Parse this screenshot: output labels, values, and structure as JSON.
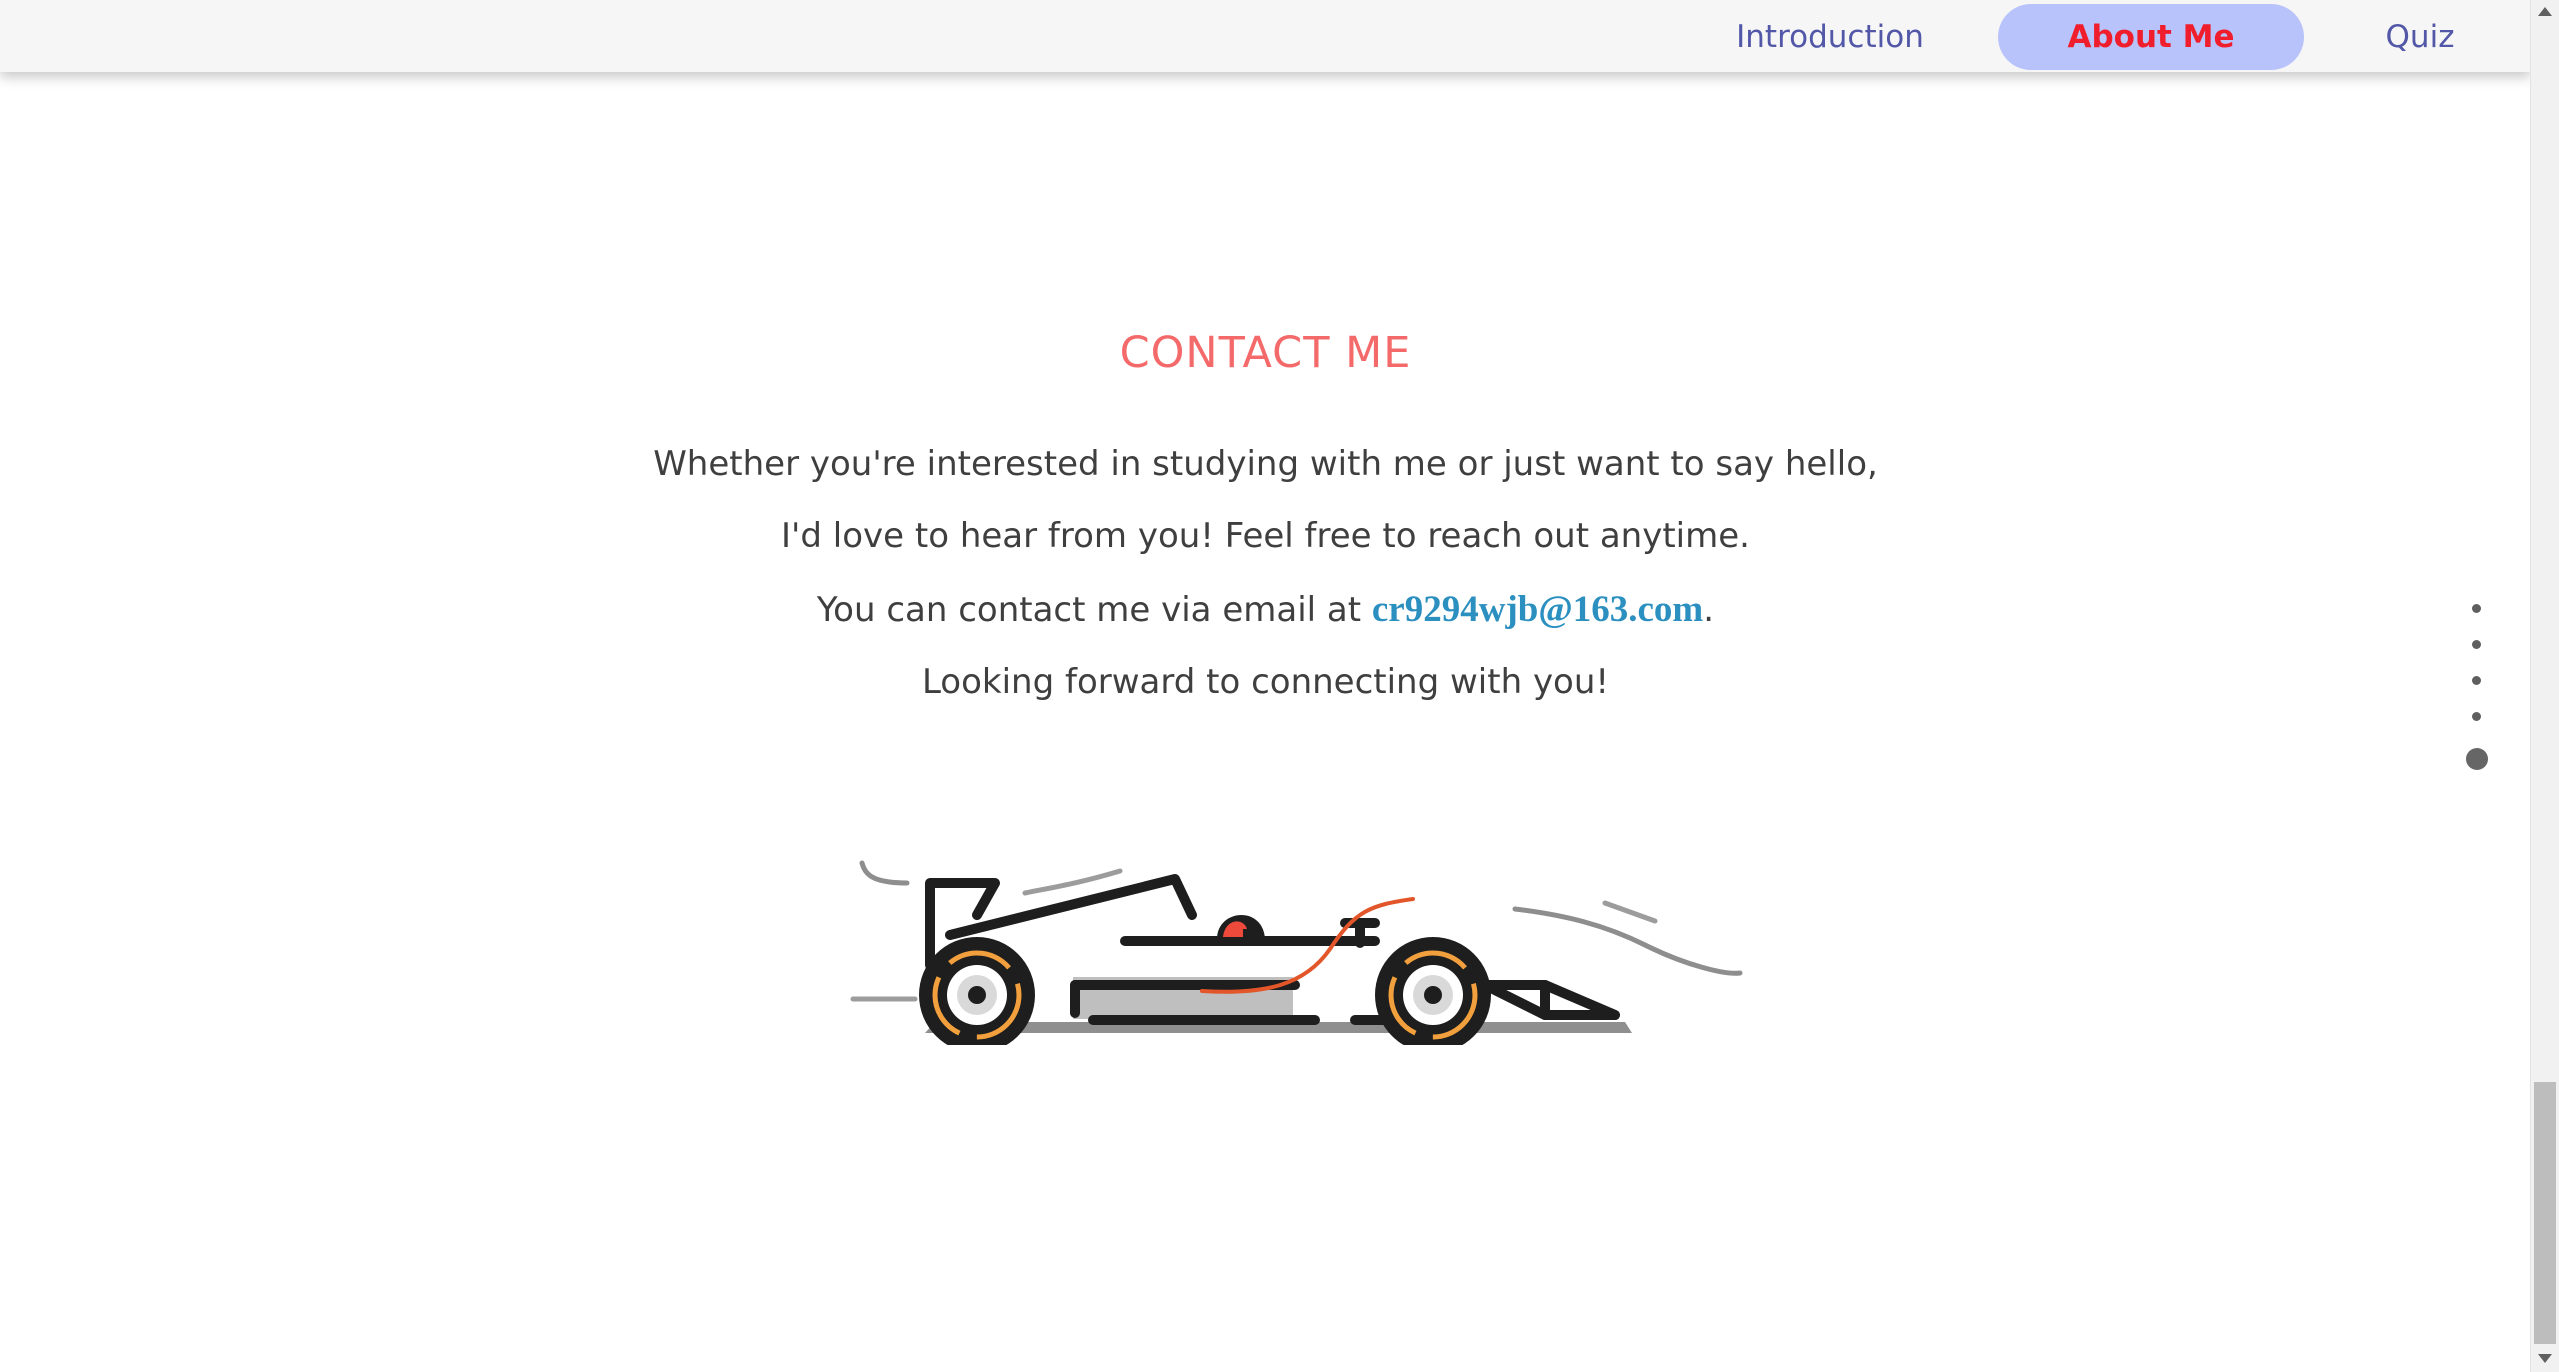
{
  "nav": {
    "items": [
      {
        "label": "Introduction"
      },
      {
        "label": "About Me"
      },
      {
        "label": "Quiz"
      }
    ],
    "active": "About Me"
  },
  "contact": {
    "title": "CONTACT ME",
    "line1": "Whether you're interested in studying with me or just want to say hello,",
    "line2": "I'd love to hear from you! Feel free to reach out anytime.",
    "line3_prefix": "You can contact me via email at ",
    "email": "cr9294wjb@163.com",
    "line3_suffix": ".",
    "line4": "Looking forward to connecting with you!"
  },
  "side_nav": {
    "dot_count": 5,
    "active_index": 5
  },
  "colors": {
    "title": "#f46a6a",
    "nav_active_bg": "#b8c3fb",
    "nav_active_text": "#f01e2c",
    "nav_text": "#5257a8",
    "email_link": "#2b8fbf",
    "body_text": "#3f3f3f"
  },
  "illustration": {
    "name": "race-car",
    "icon": "formula-race-car"
  }
}
